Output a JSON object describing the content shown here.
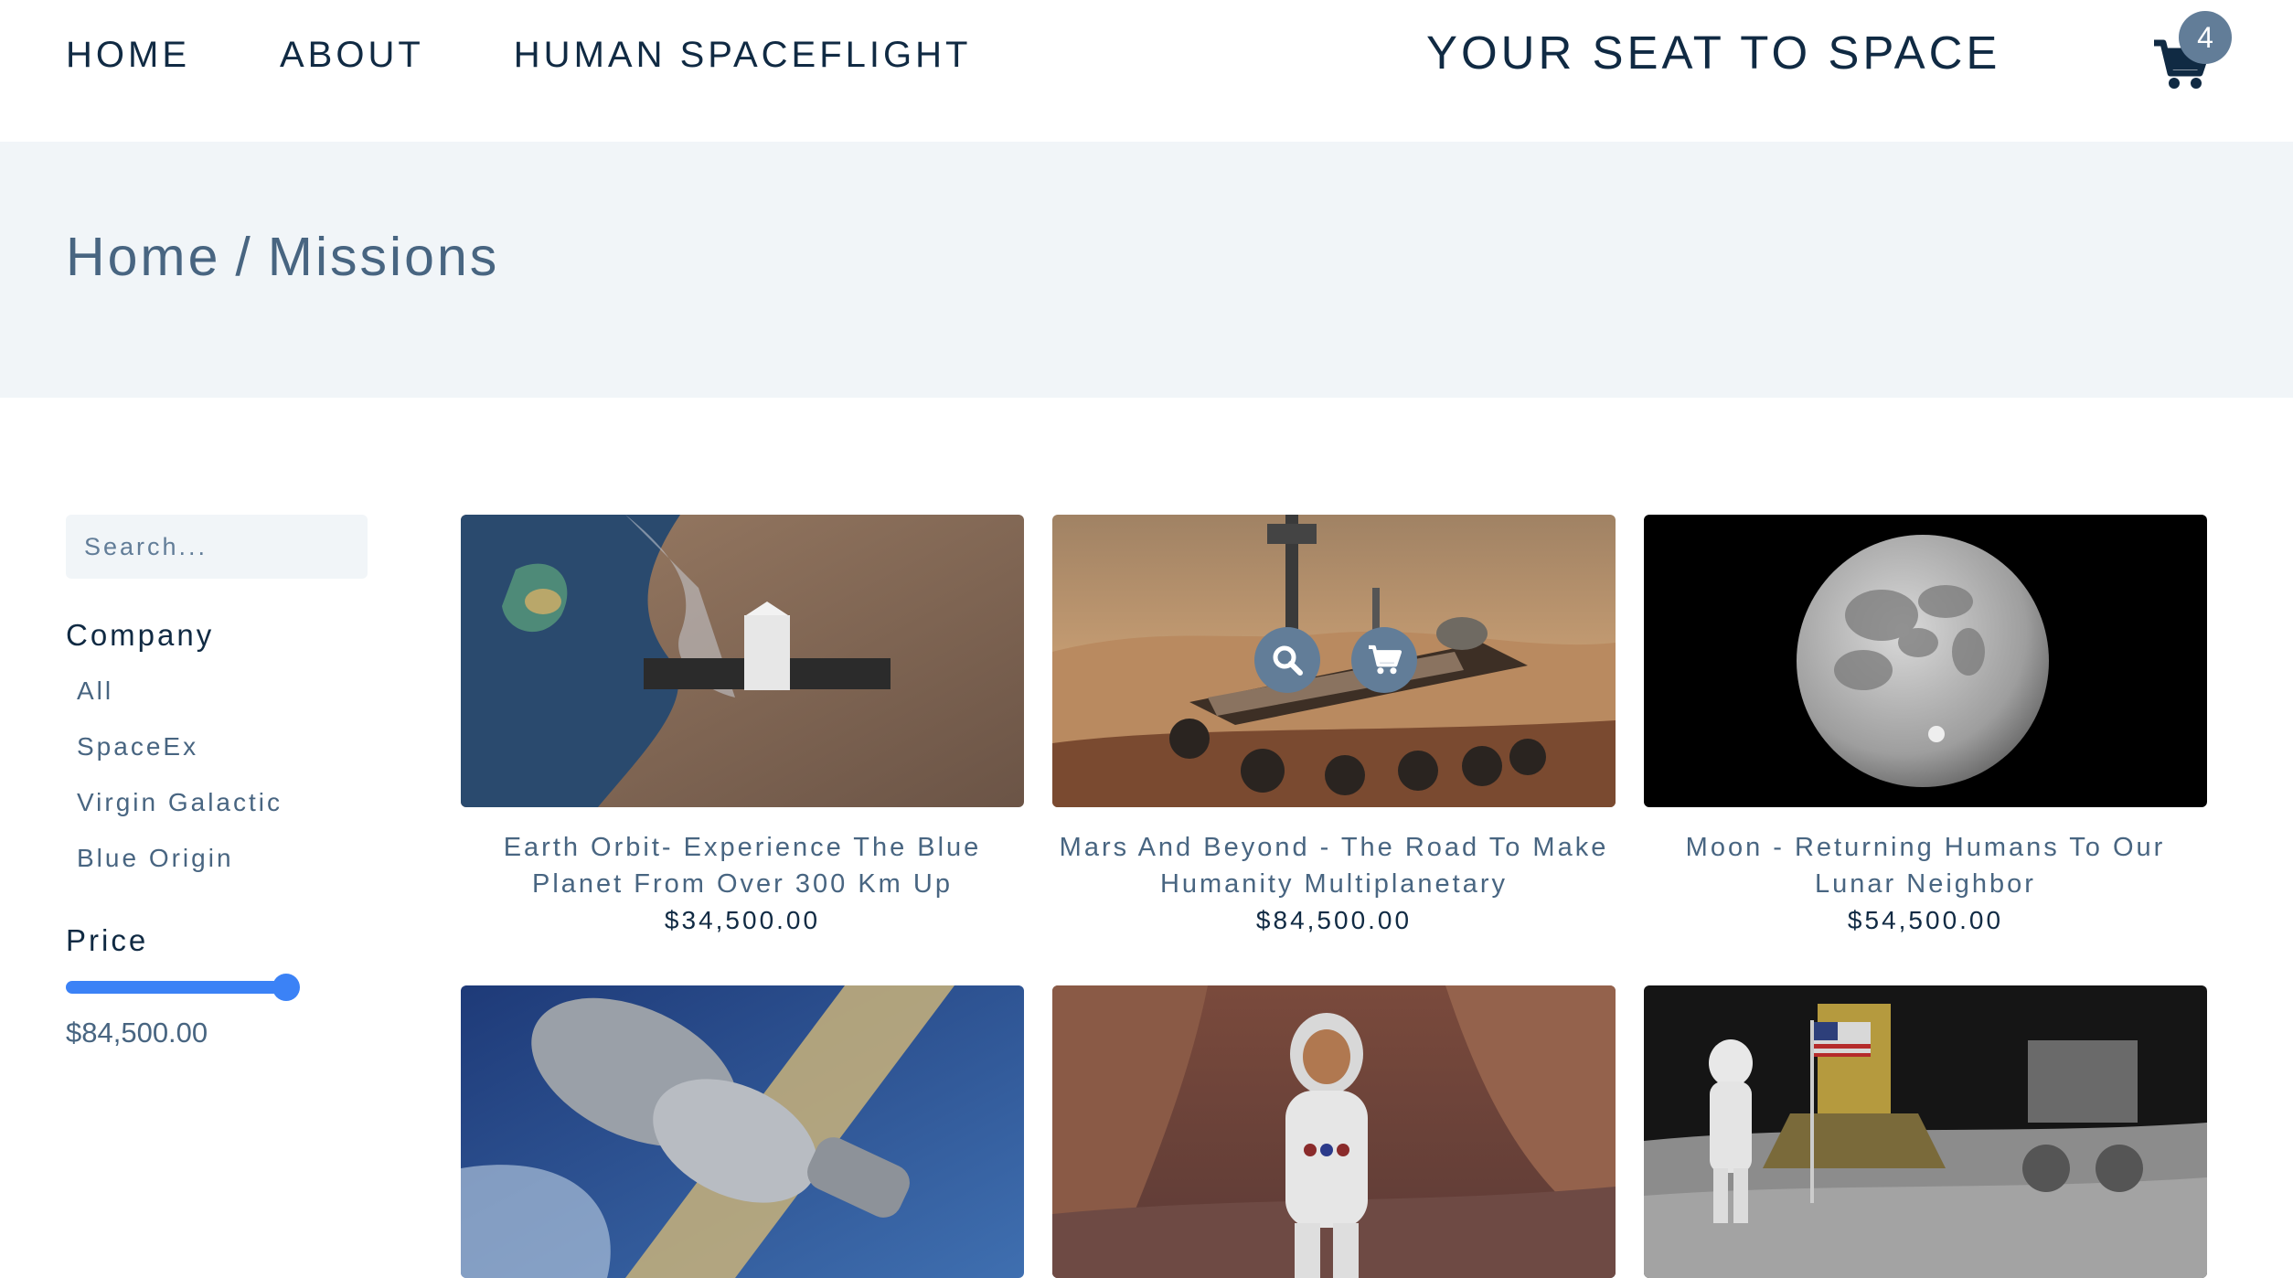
{
  "nav": {
    "links": [
      "HOME",
      "ABOUT",
      "HUMAN SPACEFLIGHT"
    ],
    "brand": "YOUR SEAT TO SPACE",
    "cart_count": "4"
  },
  "hero": {
    "home": "Home",
    "separator": "/",
    "current": "Missions"
  },
  "sidebar": {
    "search_placeholder": "Search...",
    "company_heading": "Company",
    "companies": [
      "All",
      "SpaceEx",
      "Virgin Galactic",
      "Blue Origin"
    ],
    "price_heading": "Price",
    "price_value": "$84,500.00",
    "price_slider_fraction": 1.0
  },
  "products": [
    {
      "name": "Earth Orbit- Experience The Blue Planet From Over 300 Km Up",
      "price": "$34,500.00",
      "image": "earth-orbit-capsule"
    },
    {
      "name": "Mars And Beyond - The Road To Make Humanity Multiplanetary",
      "price": "$84,500.00",
      "image": "mars-rover"
    },
    {
      "name": "Moon - Returning Humans To Our Lunar Neighbor",
      "price": "$54,500.00",
      "image": "full-moon"
    },
    {
      "image": "soyuz-spacecraft"
    },
    {
      "image": "astronaut-on-mars"
    },
    {
      "image": "apollo-moon-landing"
    }
  ],
  "colors": {
    "primary_text": "#102a43",
    "secondary_text": "#486581",
    "hero_bg": "#f1f5f8",
    "accent_badge": "#627d98",
    "slider": "#3b82f6"
  },
  "icons": [
    "cart-icon",
    "search-icon",
    "cart-icon"
  ]
}
